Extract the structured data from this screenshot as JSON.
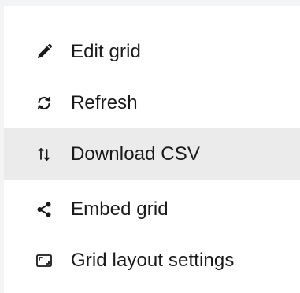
{
  "menu": {
    "items": [
      {
        "label": "Edit grid",
        "icon": "pencil-icon"
      },
      {
        "label": "Refresh",
        "icon": "refresh-icon"
      },
      {
        "label": "Download CSV",
        "icon": "sort-arrows-icon",
        "active": true
      },
      {
        "label": "Embed grid",
        "icon": "share-icon"
      },
      {
        "label": "Grid layout settings",
        "icon": "layout-icon"
      }
    ]
  },
  "colors": {
    "text": "#1a1a1a",
    "hover_background": "#ebebeb",
    "edge": "#f3f4f6",
    "icon": "#1a1a1a"
  }
}
